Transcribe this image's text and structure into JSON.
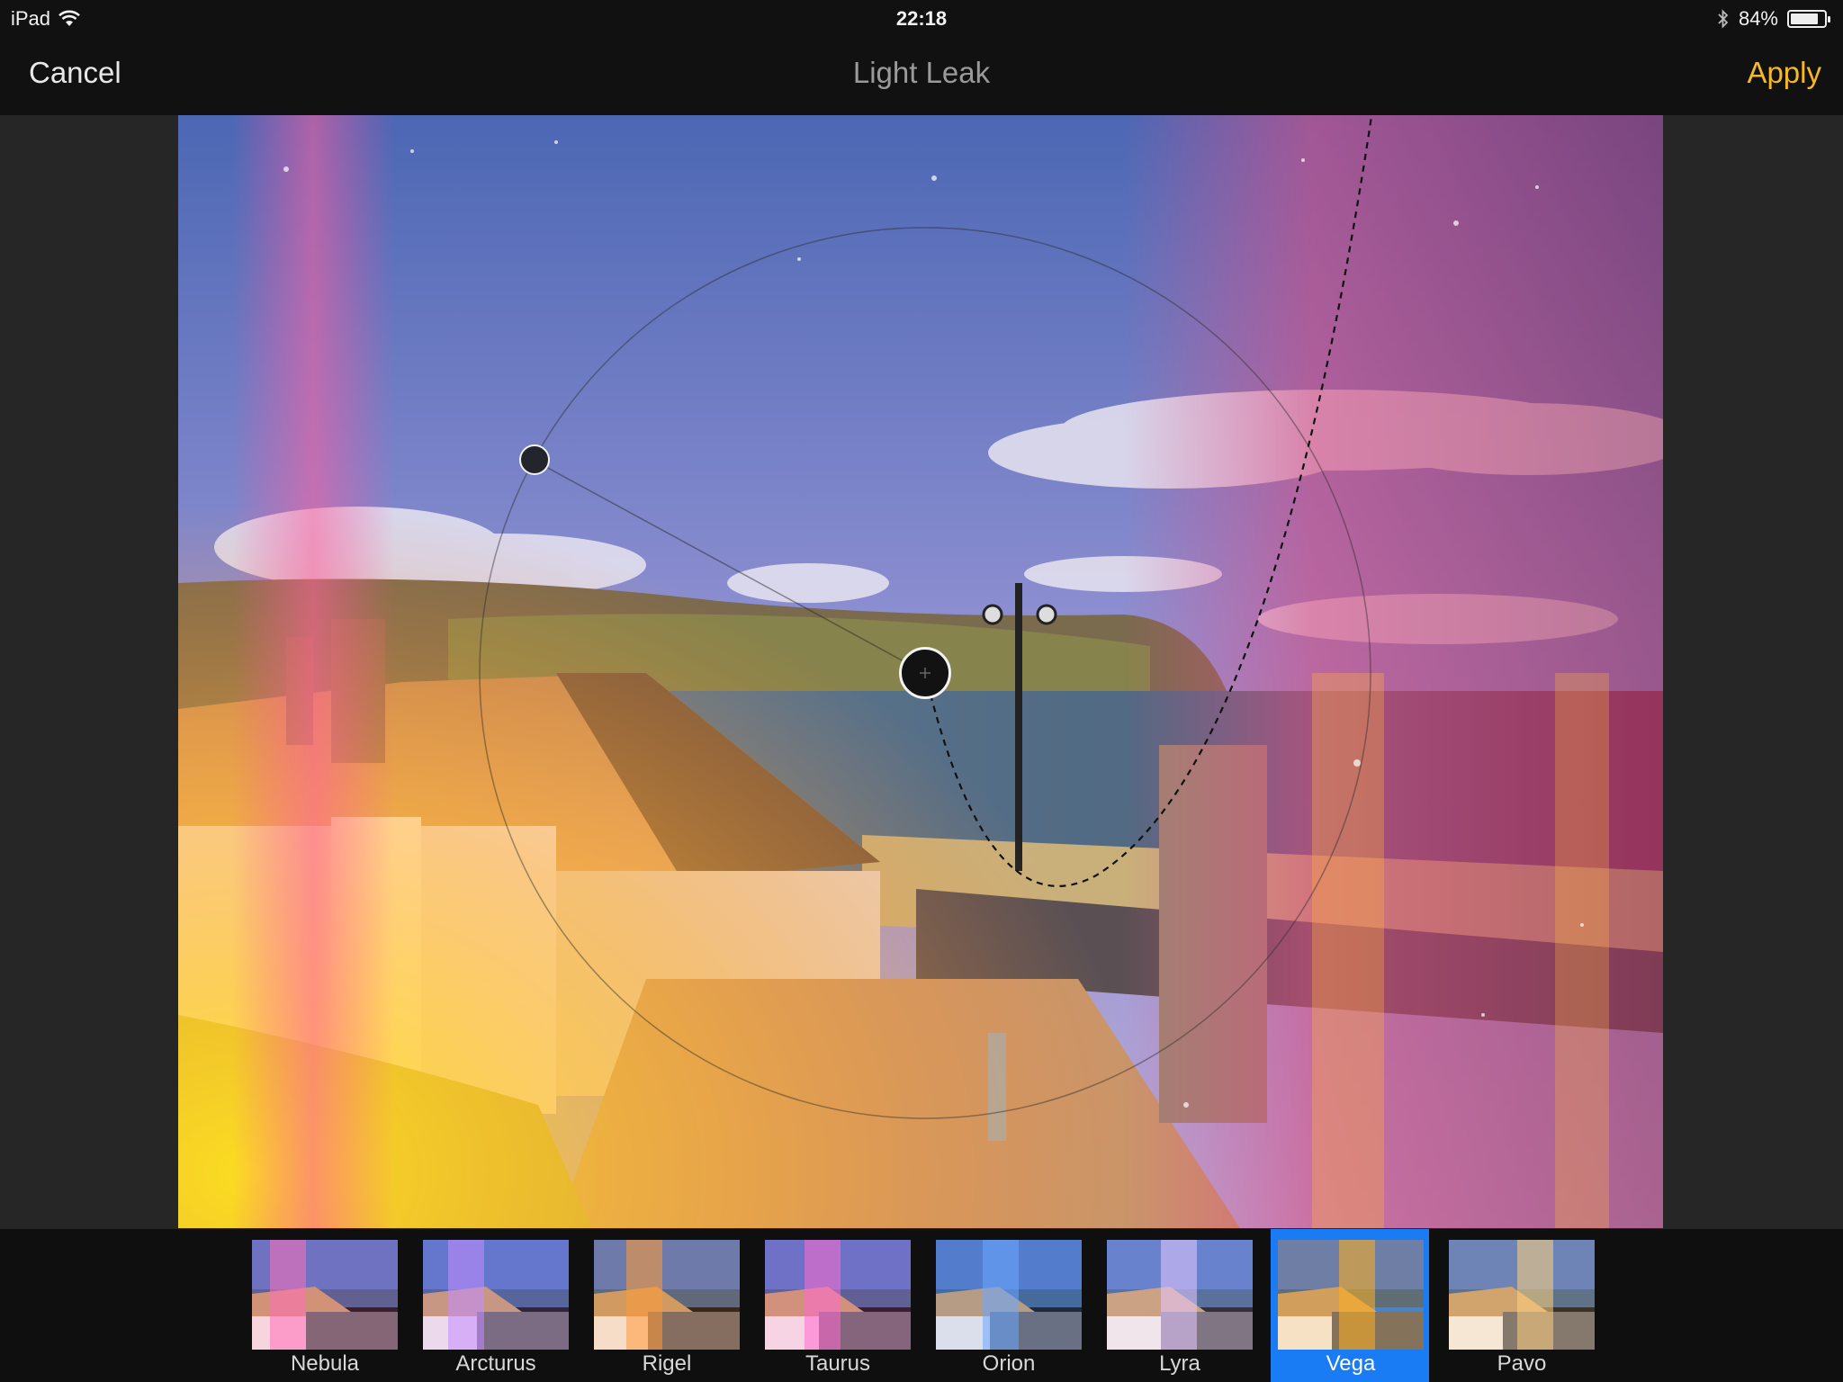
{
  "status": {
    "device": "iPad",
    "time": "22:18",
    "battery": "84%",
    "battery_level": 0.84
  },
  "nav": {
    "cancel_label": "Cancel",
    "title": "Light Leak",
    "apply_label": "Apply"
  },
  "filters": {
    "selected": "Vega",
    "items": [
      {
        "name": "Nebula"
      },
      {
        "name": "Arcturus"
      },
      {
        "name": "Rigel"
      },
      {
        "name": "Taurus"
      },
      {
        "name": "Orion"
      },
      {
        "name": "Lyra"
      },
      {
        "name": "Vega"
      },
      {
        "name": "Pavo"
      }
    ]
  },
  "colors": {
    "apply": "#f5b924",
    "selection": "#1a7cf5",
    "toolbar": "#111111"
  }
}
